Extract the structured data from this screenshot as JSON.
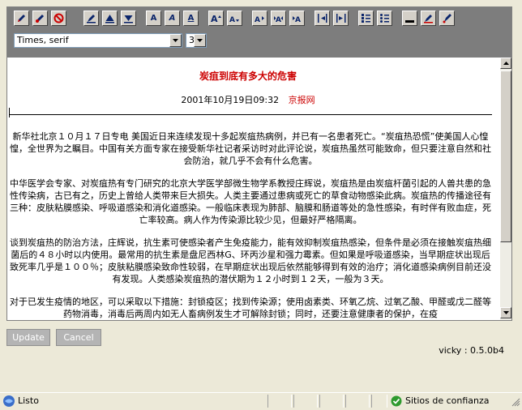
{
  "toolbar": {
    "font_family": "Times, serif",
    "font_size": "3",
    "buttons": [
      {
        "name": "pencil-icon",
        "glyph": ""
      },
      {
        "name": "brush-icon",
        "glyph": ""
      },
      {
        "name": "no-entry-icon",
        "glyph": ""
      },
      {
        "name": "erase-format-icon",
        "glyph": ""
      },
      {
        "name": "triangle-up-icon",
        "glyph": ""
      },
      {
        "name": "triangle-down-icon",
        "glyph": ""
      },
      {
        "name": "bold-icon",
        "glyph": "A"
      },
      {
        "name": "italic-icon",
        "glyph": "A"
      },
      {
        "name": "underline-icon",
        "glyph": "A"
      }
    ]
  },
  "article": {
    "title": "炭疽到底有多大的危害",
    "datetime": "2001年10月19日09:32",
    "source": "京报网",
    "paragraphs": [
      "新华社北京１０月１７日专电 美国近日来连续发现十多起炭疽热病例，并已有一名患者死亡。“炭疽热恐慌”使美国人心惶惶，全世界为之瞩目。中国有关方面专家在接受新华社记者采访时对此评论说，炭疽热虽然可能致命，但只要注意自然和社会防治，就几乎不会有什么危害。",
      "中华医学会专家、对炭疽热有专门研究的北京大学医学部微生物学系教授庄辉说，炭疽热是由炭疽杆菌引起的人兽共患的急性传染病，古已有之，历史上曾给人类带来巨大损失。人类主要通过患病或死亡的草食动物感染此病。炭疽热的传播途径有三种：皮肤粘膜感染、呼吸道感染和消化道感染。一般临床表现为肺部、脑膜和肠道等处的急性感染，有时伴有败血症，死亡率较高。病人作为传染源比较少见，但最好严格隔离。",
      "谈到炭疽热的防治方法，庄辉说，抗生素可使感染者产生免疫能力，能有效抑制炭疽热感染，但条件是必须在接触炭疽热细菌后的４８小时以内使用。最常用的抗生素是盘尼西林G、环丙沙星和强力霉素。但如果是呼吸道感染，当早期症状出现后致死率几乎是１００％；皮肤粘膜感染致命性较弱，在早期症状出现后依然能够得到有效的治疗；消化道感染病例目前还没有发现。人类感染炭疽热的潜伏期为１２小时到１２天，一般为３天。",
      "对于已发生疫情的地区，可以采取以下措施：封锁疫区；找到传染源；使用卤素类、环氧乙烷、过氧乙酸、甲醛或戊二醛等药物消毒，消毒后两周内如无人畜病例发生才可解除封锁；同时，还要注意健康者的保护，在疫"
    ]
  },
  "form": {
    "update_label": "Update",
    "cancel_label": "Cancel",
    "version": "vicky : 0.5.0b4"
  },
  "statusbar": {
    "status": "Listo",
    "zone": "Sitios de confianza"
  }
}
